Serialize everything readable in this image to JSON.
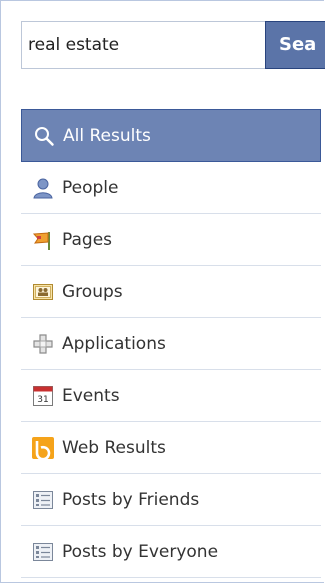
{
  "search": {
    "value": "real estate",
    "button_label": "Sea"
  },
  "nav": {
    "items": [
      {
        "label": "All Results",
        "icon": "search-icon",
        "active": true
      },
      {
        "label": "People",
        "icon": "person-icon"
      },
      {
        "label": "Pages",
        "icon": "flag-icon"
      },
      {
        "label": "Groups",
        "icon": "group-icon"
      },
      {
        "label": "Applications",
        "icon": "puzzle-icon"
      },
      {
        "label": "Events",
        "icon": "calendar-icon",
        "calendar_day": "31"
      },
      {
        "label": "Web Results",
        "icon": "bing-icon"
      },
      {
        "label": "Posts by Friends",
        "icon": "posts-icon"
      },
      {
        "label": "Posts by Everyone",
        "icon": "posts-icon"
      }
    ]
  },
  "colors": {
    "active_bg": "#6d84b4",
    "button_bg": "#5b74a8",
    "divider": "#d8dfea"
  }
}
